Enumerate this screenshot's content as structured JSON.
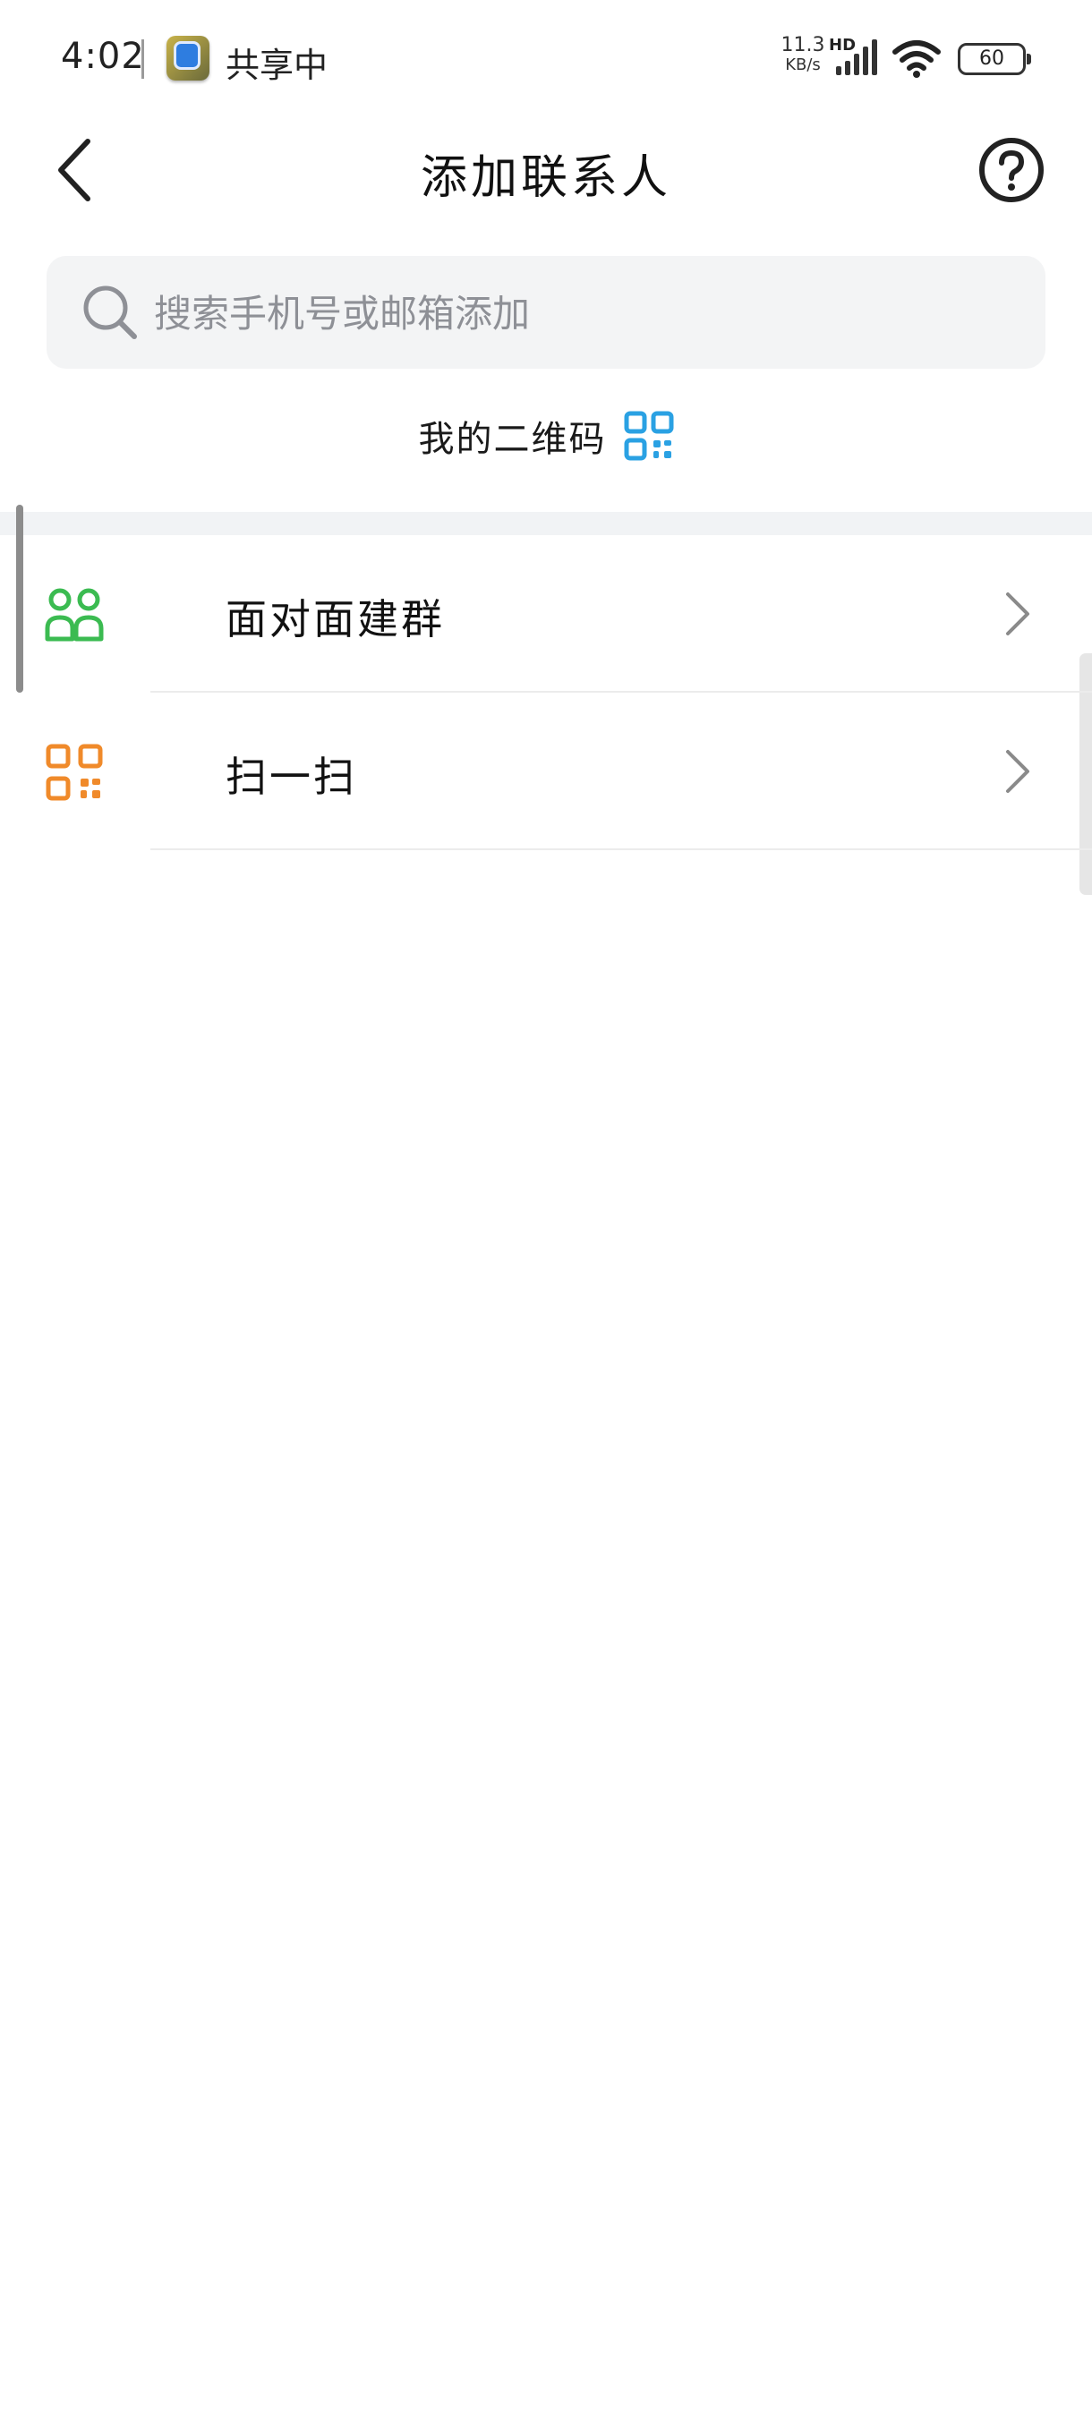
{
  "status_bar": {
    "time": "4:02",
    "sharing_text": "共享中",
    "net_speed_value": "11.3",
    "net_speed_unit": "KB/s",
    "hd_label": "HD",
    "battery_level": "60"
  },
  "nav": {
    "title": "添加联系人",
    "back_icon": "chevron-left-icon",
    "help_icon": "question-circle-icon"
  },
  "search": {
    "placeholder": "搜索手机号或邮箱添加",
    "value": ""
  },
  "my_qr": {
    "label": "我的二维码",
    "icon_color": "#2aa1e3"
  },
  "menu": {
    "items": [
      {
        "label": "面对面建群",
        "icon": "group-people-icon",
        "icon_color": "#3bbb51"
      },
      {
        "label": "扫一扫",
        "icon": "scan-qr-icon",
        "icon_color": "#f08a2a"
      }
    ]
  }
}
